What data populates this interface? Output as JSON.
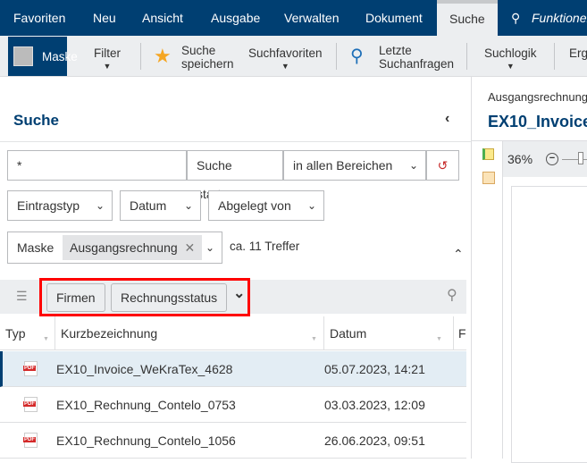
{
  "nav": {
    "items": [
      "Favoriten",
      "Neu",
      "Ansicht",
      "Ausgabe",
      "Verwalten",
      "Dokument"
    ],
    "active": "Suche",
    "search_placeholder": "Funktionen"
  },
  "toolbar": {
    "maske": "Maske",
    "filter": "Filter",
    "save_line1": "Suche",
    "save_line2": "speichern",
    "favorites": "Suchfavoriten",
    "recent_line1": "Letzte",
    "recent_line2": "Suchanfragen",
    "logic": "Suchlogik",
    "erg": "Erg"
  },
  "search": {
    "title": "Suche",
    "query": "*",
    "start": "Suche starten",
    "scope": "in allen Bereichen",
    "filters": [
      "Eintragstyp",
      "Datum",
      "Abgelegt von"
    ],
    "mask_label": "Maske",
    "mask_value": "Ausgangsrechnung",
    "hits": "ca. 11 Treffer"
  },
  "facets": {
    "buttons": [
      "Firmen",
      "Rechnungsstatus"
    ]
  },
  "table": {
    "headers": [
      "Typ",
      "Kurzbezeichnung",
      "Datum",
      "F"
    ],
    "rows": [
      {
        "type": "PDF",
        "name": "EX10_Invoice_WeKraTex_4628",
        "date": "05.07.2023, 14:21"
      },
      {
        "type": "PDF",
        "name": "EX10_Rechnung_Contelo_0753",
        "date": "03.03.2023, 12:09"
      },
      {
        "type": "PDF",
        "name": "EX10_Rechnung_Contelo_1056",
        "date": "26.06.2023, 09:51"
      }
    ]
  },
  "preview": {
    "subtitle": "Ausgangsrechnung",
    "title": "EX10_Invoice",
    "zoom": "36%"
  },
  "colors": {
    "navy": "#003f72",
    "selected": "#e3edf4",
    "highlight": "#ff0000"
  }
}
